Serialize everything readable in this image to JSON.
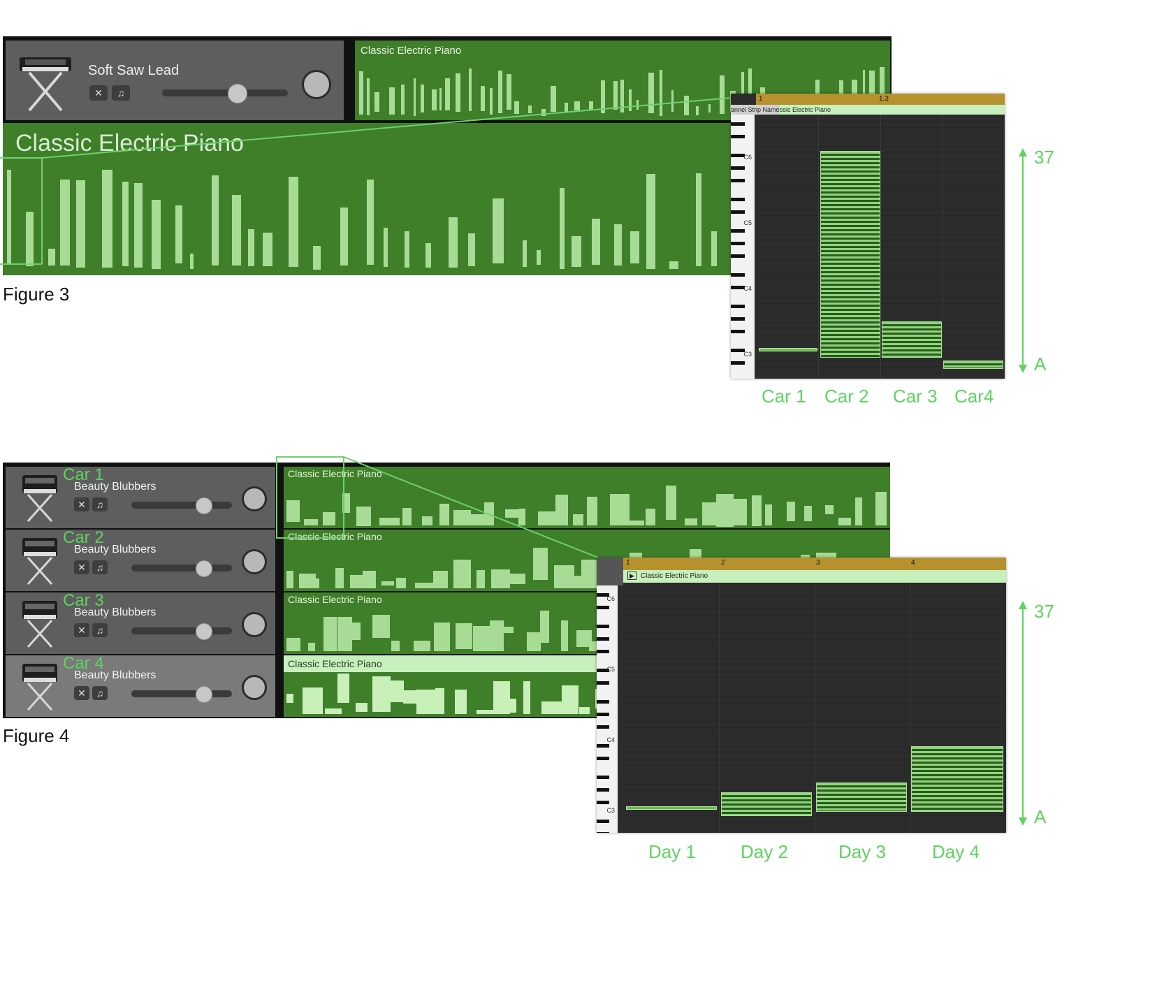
{
  "figure3": {
    "caption": "Figure 3",
    "track": {
      "name": "Soft Saw Lead"
    },
    "region_name": "Classic Electric Piano",
    "region_name_big": "Classic Electric Piano",
    "roll": {
      "ruler_marks": [
        "1",
        "1.3"
      ],
      "strip_label": "annel Strip Name",
      "region_label": "ssic Electric Piano",
      "key_labels": [
        "C6",
        "C5",
        "C4",
        "C3"
      ]
    },
    "axis_top": "37",
    "axis_bottom": "A",
    "group_labels": [
      "Car 1",
      "Car 2",
      "Car 3",
      "Car4"
    ]
  },
  "figure4": {
    "caption": "Figure 4",
    "tracks": [
      {
        "car": "Car 1",
        "name": "Beauty Blubbers",
        "region": "Classic Electric Piano"
      },
      {
        "car": "Car 2",
        "name": "Beauty Blubbers",
        "region": "Classic Electric Piano"
      },
      {
        "car": "Car 3",
        "name": "Beauty Blubbers",
        "region": "Classic Electric Piano"
      },
      {
        "car": "Car 4",
        "name": "Beauty Blubbers",
        "region": "Classic Electric Piano"
      }
    ],
    "roll": {
      "ruler_marks": [
        "1",
        "2",
        "3",
        "4"
      ],
      "region_label": "Classic Electric Piano",
      "key_labels": [
        "C6",
        "C5",
        "C4",
        "C3"
      ]
    },
    "axis_top": "37",
    "axis_bottom": "A",
    "group_labels": [
      "Day 1",
      "Day 2",
      "Day 3",
      "Day 4"
    ]
  },
  "icons": {
    "instrument": "keyboard-stand-icon",
    "mute": "speaker-mute-icon",
    "solo": "headphones-icon",
    "pan": "pan-knob-icon"
  },
  "colors": {
    "region": "#3f7f2a",
    "note": "#a8dc96",
    "accent": "#5fd35f",
    "ruler": "#b5922e"
  }
}
